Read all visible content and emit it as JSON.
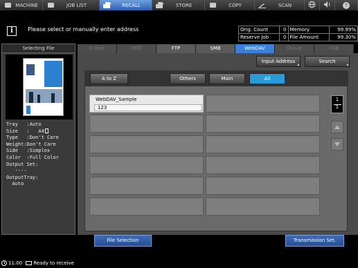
{
  "nav": {
    "machine": "MACHINE",
    "job_list": "JOB LIST",
    "recall": "RECALL",
    "store": "STORE",
    "copy": "COPY",
    "scan": "SCAN"
  },
  "message": "Please select or manually enter address",
  "status": {
    "orig_count_label": "Orig. Count",
    "orig_count": "0",
    "reserve_job_label": "Reserve Job",
    "reserve_job": "0",
    "memory_label": "Memory",
    "memory": "99.99%",
    "file_amount_label": "File Amount",
    "file_amount": "99.30%"
  },
  "left_pane": {
    "title": "Selecting File",
    "props": {
      "tray_label": "Tray",
      "tray": "Auto",
      "size_label": "Size",
      "size": "A4",
      "type_label": "Type",
      "type": "Don't Care",
      "weight_label": "Weight",
      "weight": "Don't Care",
      "side_label": "Side",
      "side": "Simplex",
      "color_label": "Color",
      "color": "Full Color",
      "output_set_label": "Output Set",
      "output_set": "----",
      "output_tray_label": "OutputTray",
      "output_tray": "Auto"
    }
  },
  "tabs": [
    "E-mail",
    "HDD",
    "FTP",
    "SMB",
    "WebDAV",
    "Group",
    "USB"
  ],
  "buttons": {
    "input_address": "Input Address",
    "search": "Search",
    "a_to_z": "A to Z",
    "others": "Others",
    "main": "Main",
    "all": "All",
    "file_selection": "File Selection",
    "transmission_set": "Transmission Set."
  },
  "entries": [
    {
      "name": "WebDAV_Sample",
      "detail": "123"
    }
  ],
  "pager": {
    "current": "1",
    "total": "1"
  },
  "statusbar": {
    "time": "11:00",
    "status": "Ready to receive"
  },
  "colors": {
    "accent": "#3a7fd8",
    "selected_filter": "#2a9ad8",
    "bottom_button": "#2a4e8f"
  }
}
